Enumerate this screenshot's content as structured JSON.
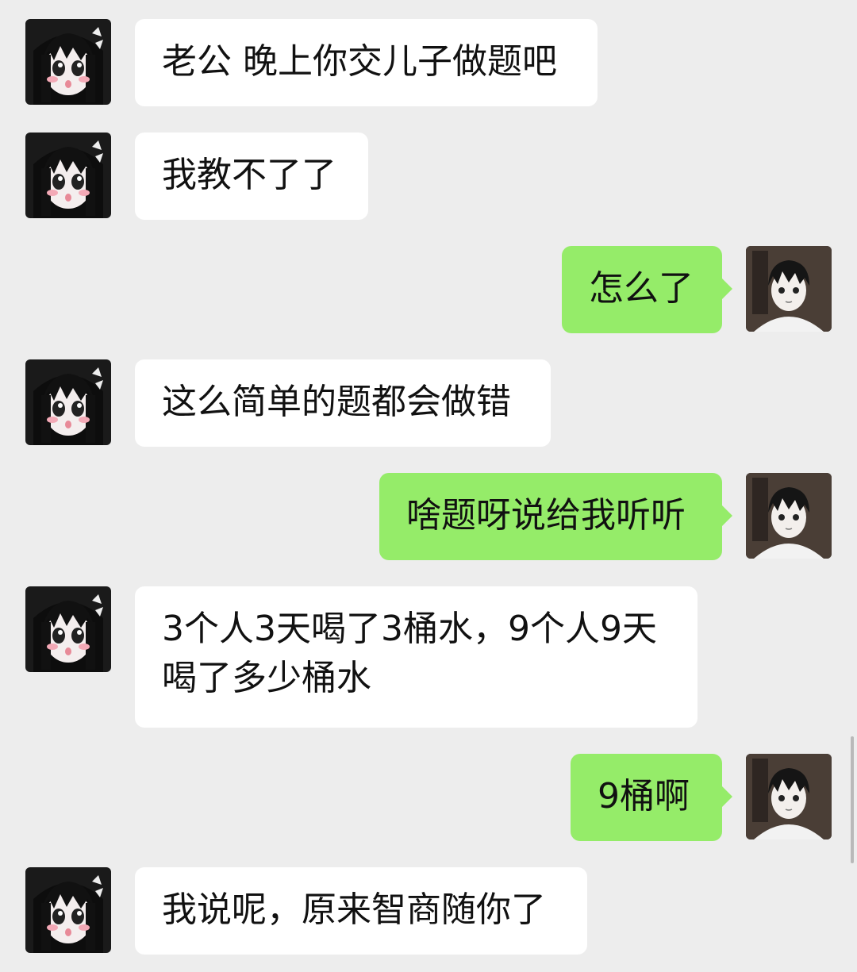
{
  "messages": [
    {
      "side": "in",
      "text": "老公 晚上你交儿子做题吧"
    },
    {
      "side": "in",
      "text": "我教不了了"
    },
    {
      "side": "out",
      "text": "怎么了"
    },
    {
      "side": "in",
      "text": "这么简单的题都会做错"
    },
    {
      "side": "out",
      "text": "啥题呀说给我听听"
    },
    {
      "side": "in",
      "text": "3个人3天喝了3桶水，9个人9天喝了多少桶水"
    },
    {
      "side": "out",
      "text": "9桶啊"
    },
    {
      "side": "in",
      "text": "我说呢，原来智商随你了"
    }
  ],
  "colors": {
    "background": "#ededed",
    "incoming_bubble": "#ffffff",
    "outgoing_bubble": "#95ec69"
  },
  "icons": {
    "incoming_avatar": "anime-girl-avatar",
    "outgoing_avatar": "anime-boy-avatar"
  }
}
